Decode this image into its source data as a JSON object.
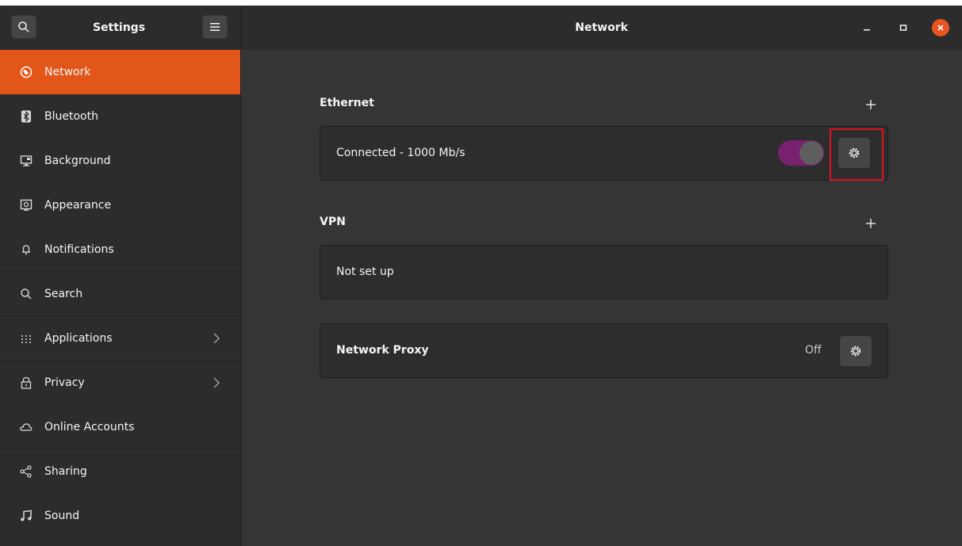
{
  "app": {
    "sidebar_title": "Settings",
    "window_title": "Network"
  },
  "colors": {
    "accent": "#e2561a",
    "toggle_on": "#77216f",
    "highlight": "#e0111e"
  },
  "sidebar": {
    "items": [
      {
        "label": "Network",
        "icon": "network-globe-icon",
        "active": true
      },
      {
        "label": "Bluetooth",
        "icon": "bluetooth-icon"
      },
      {
        "label": "Background",
        "icon": "background-monitor-icon"
      },
      {
        "label": "Appearance",
        "icon": "appearance-icon"
      },
      {
        "label": "Notifications",
        "icon": "bell-icon"
      },
      {
        "label": "Search",
        "icon": "search-icon"
      },
      {
        "label": "Applications",
        "icon": "apps-grid-icon",
        "has_submenu": true
      },
      {
        "label": "Privacy",
        "icon": "lock-icon",
        "has_submenu": true
      },
      {
        "label": "Online Accounts",
        "icon": "cloud-icon"
      },
      {
        "label": "Sharing",
        "icon": "share-icon"
      },
      {
        "label": "Sound",
        "icon": "music-note-icon"
      }
    ]
  },
  "main": {
    "ethernet": {
      "title": "Ethernet",
      "status": "Connected - 1000 Mb/s",
      "toggle_on": true
    },
    "vpn": {
      "title": "VPN",
      "status": "Not set up"
    },
    "proxy": {
      "title": "Network Proxy",
      "state": "Off"
    }
  }
}
